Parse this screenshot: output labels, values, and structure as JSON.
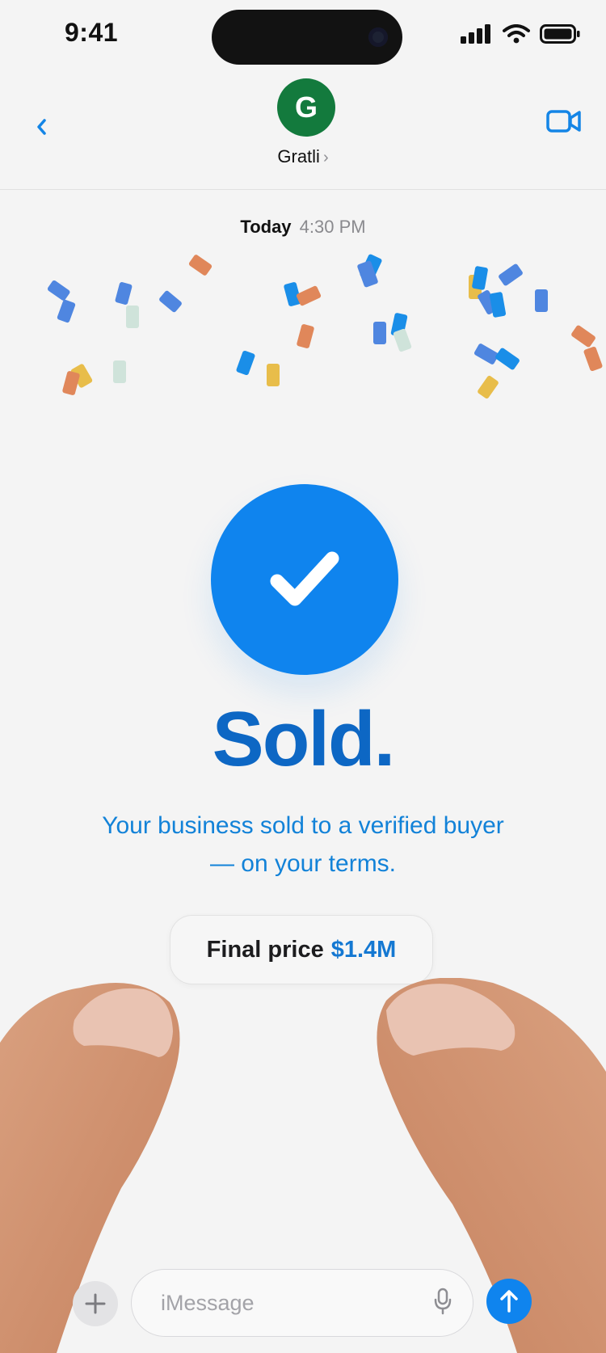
{
  "status_bar": {
    "time": "9:41"
  },
  "header": {
    "avatar_initial": "G",
    "contact_name": "Gratli",
    "chevron": "›"
  },
  "icons": {
    "back": "chevron-left-icon",
    "video": "video-camera-icon",
    "check": "checkmark-icon",
    "plus": "plus-icon",
    "mic": "microphone-icon",
    "send": "arrow-up-icon"
  },
  "thread": {
    "day": "Today",
    "time": "4:30 PM"
  },
  "card": {
    "headline": "Sold.",
    "subtext_line1": "Your business sold to a verified buyer",
    "subtext_line2": "— on your terms.",
    "price_label": "Final price",
    "price_value": "$1.4M"
  },
  "composer": {
    "placeholder": "iMessage"
  },
  "colors": {
    "accent": "#0f84ee",
    "headline": "#0d67c4",
    "avatar": "#137a3d",
    "confetti_blue": "#4f86e0",
    "confetti_orange": "#e0875a",
    "confetti_yellow": "#e8bd4a",
    "confetti_mint": "#cfe3da"
  }
}
